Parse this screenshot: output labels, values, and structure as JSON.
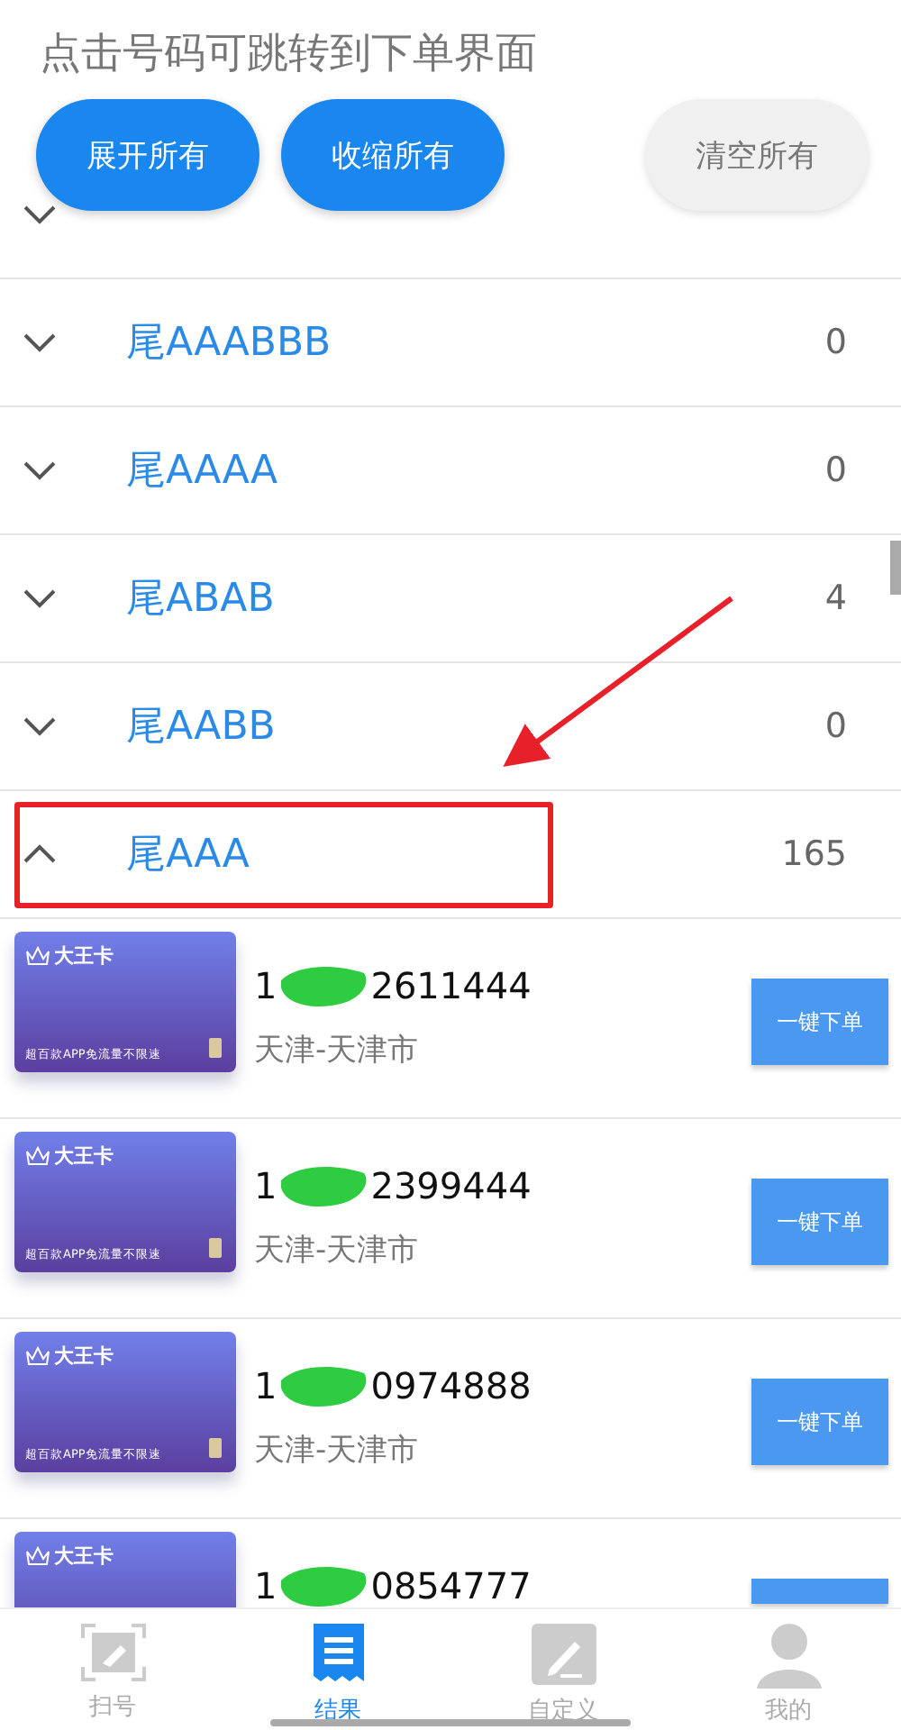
{
  "hint": "点击号码可跳转到下单界面",
  "buttons": [
    {
      "label": "展开所有",
      "kind": "primary"
    },
    {
      "label": "收缩所有",
      "kind": "primary"
    },
    {
      "label": "清空所有",
      "kind": "secondary"
    }
  ],
  "groups": [
    {
      "expanded": false
    },
    {
      "label": "尾AAABBB",
      "count": "0",
      "expanded": false
    },
    {
      "label": "尾AAAA",
      "count": "0",
      "expanded": false
    },
    {
      "label": "尾ABAB",
      "count": "4",
      "expanded": false
    },
    {
      "label": "尾AABB",
      "count": "0",
      "expanded": false
    },
    {
      "label": "尾AAA",
      "count": "165",
      "expanded": true,
      "highlighted": true
    }
  ],
  "items": [
    {
      "brand": "大王卡",
      "slogan": "超百款APP免流量不限速",
      "number_start": "1",
      "number_end": "2611444",
      "region": "天津-天津市",
      "action": "一键下单"
    },
    {
      "brand": "大王卡",
      "slogan": "超百款APP免流量不限速",
      "number_start": "1",
      "number_end": "2399444",
      "region": "天津-天津市",
      "action": "一键下单"
    },
    {
      "brand": "大王卡",
      "slogan": "超百款APP免流量不限速",
      "number_start": "1",
      "number_end": "0974888",
      "region": "天津-天津市",
      "action": "一键下单"
    },
    {
      "brand": "大王卡",
      "number_start": "1",
      "number_end": "0854777"
    }
  ],
  "nav": [
    {
      "label": "扫号",
      "kind": "scan",
      "selected": false
    },
    {
      "label": "结果",
      "kind": "list",
      "selected": true
    },
    {
      "label": "自定义",
      "kind": "edit",
      "selected": false
    },
    {
      "label": "我的",
      "kind": "user",
      "selected": false
    }
  ]
}
